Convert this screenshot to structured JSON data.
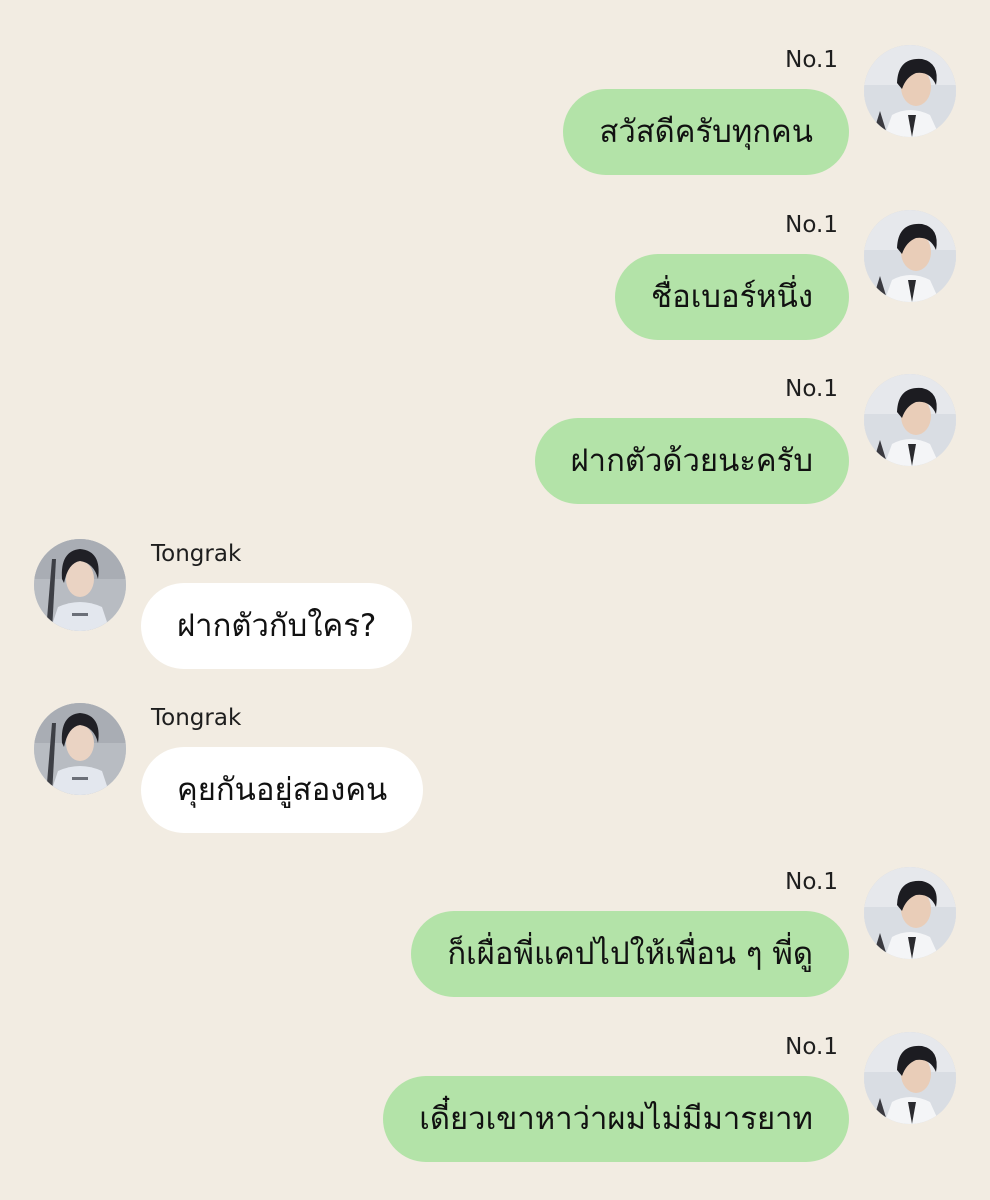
{
  "messages": [
    {
      "side": "out",
      "sender": "No.1",
      "text": "สวัสดีครับทุกคน"
    },
    {
      "side": "out",
      "sender": "No.1",
      "text": "ชื่อเบอร์หนึ่ง"
    },
    {
      "side": "out",
      "sender": "No.1",
      "text": "ฝากตัวด้วยนะครับ"
    },
    {
      "side": "in",
      "sender": "Tongrak",
      "text": "ฝากตัวกับใคร?"
    },
    {
      "side": "in",
      "sender": "Tongrak",
      "text": "คุยกันอยู่สองคน"
    },
    {
      "side": "out",
      "sender": "No.1",
      "text": "ก็เผื่อพี่แคปไปให้เพื่อน ๆ พี่ดู"
    },
    {
      "side": "out",
      "sender": "No.1",
      "text": "เดี๋ยวเขาหาว่าผมไม่มีมารยาท"
    }
  ],
  "colors": {
    "background": "#f2ece2",
    "outgoing_bubble": "#b3e3a8",
    "incoming_bubble": "#ffffff"
  }
}
